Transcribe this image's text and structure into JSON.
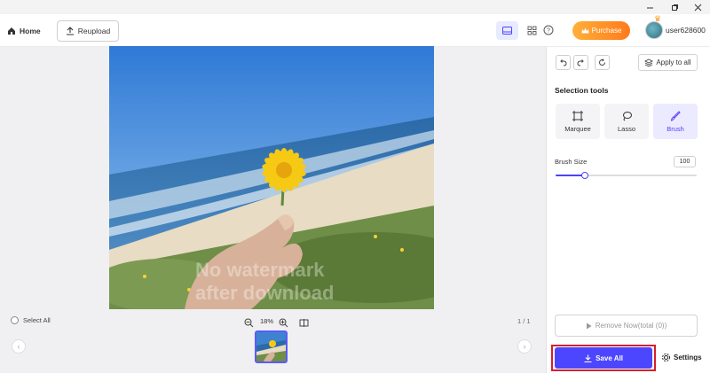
{
  "header": {
    "home_label": "Home",
    "reupload_label": "Reupload",
    "purchase_label": "Purchase",
    "username": "user628600"
  },
  "canvas": {
    "watermark_line1": "No watermark",
    "watermark_line2": "after download",
    "select_all_label": "Select All",
    "zoom_value": "18%",
    "page_count": "1 / 1"
  },
  "panel": {
    "apply_all_label": "Apply to all",
    "section_title": "Selection tools",
    "tools": [
      {
        "label": "Marquee",
        "icon": "marquee-icon"
      },
      {
        "label": "Lasso",
        "icon": "lasso-icon"
      },
      {
        "label": "Brush",
        "icon": "brush-icon",
        "active": true
      }
    ],
    "brush_size_label": "Brush Size",
    "brush_size_value": "100",
    "brush_slider_level": 0.21,
    "remove_label": "Remove Now(total (0))",
    "save_label": "Save All",
    "settings_label": "Settings"
  },
  "colors": {
    "accent": "#4d46ff",
    "purchase": "#ff8a22",
    "highlight": "#d81e2c"
  }
}
